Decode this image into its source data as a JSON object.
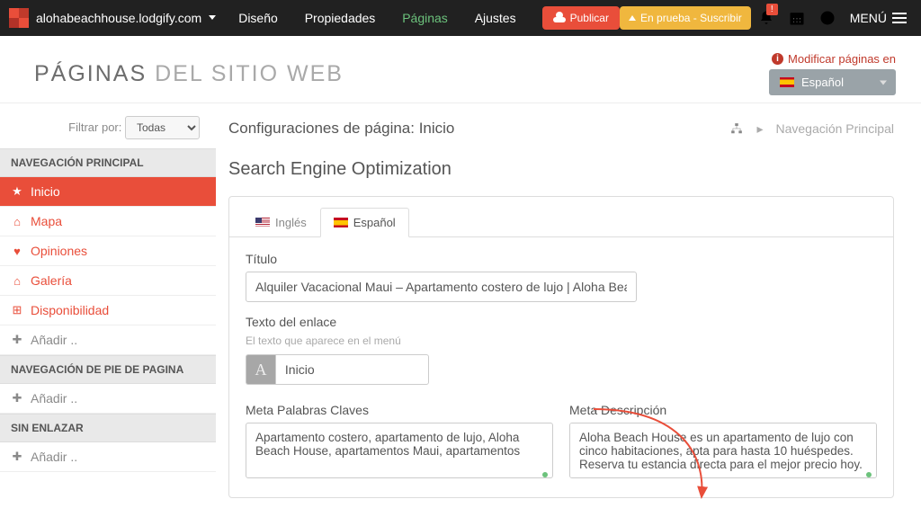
{
  "topbar": {
    "site": "alohabeachhouse.lodgify.com",
    "nav": {
      "diseno": "Diseño",
      "propiedades": "Propiedades",
      "paginas": "Páginas",
      "ajustes": "Ajustes"
    },
    "publish": "Publicar",
    "trial": "En prueba - Suscribir",
    "notif_badge": "!",
    "menu": "MENÚ"
  },
  "header": {
    "title_strong": "PÁGINAS",
    "title_thin": "DEL SITIO WEB",
    "lang_warning": "Modificar páginas en",
    "lang_selected": "Español"
  },
  "sidebar": {
    "filter_label": "Filtrar por:",
    "filter_value": "Todas",
    "sections": {
      "principal": "NAVEGACIÓN PRINCIPAL",
      "pie": "NAVEGACIÓN DE PIE DE PAGINA",
      "sin": "SIN ENLAZAR"
    },
    "items": {
      "inicio": "Inicio",
      "mapa": "Mapa",
      "opiniones": "Opiniones",
      "galeria": "Galería",
      "disponibilidad": "Disponibilidad",
      "anadir": "Añadir .."
    }
  },
  "content": {
    "config_title": "Configuraciones de página: Inicio",
    "breadcrumb": "Navegación Principal",
    "seo_heading": "Search Engine Optimization",
    "tabs": {
      "en": "Inglés",
      "es": "Español"
    },
    "form": {
      "titulo_label": "Título",
      "titulo_value": "Alquiler Vacacional Maui – Apartamento costero de lujo | Aloha Beach House",
      "enlace_label": "Texto del enlace",
      "enlace_hint": "El texto que aparece en el menú",
      "enlace_value": "Inicio",
      "meta_kw_label": "Meta Palabras Claves",
      "meta_kw_value": "Apartamento costero, apartamento de lujo, Aloha Beach House, apartamentos Maui, apartamentos",
      "meta_desc_label": "Meta Descripción",
      "meta_desc_value": "Aloha Beach House es un apartamento de lujo con cinco habitaciones, apta para hasta 10 huéspedes. Reserva tu estancia directa para el mejor precio hoy."
    }
  }
}
